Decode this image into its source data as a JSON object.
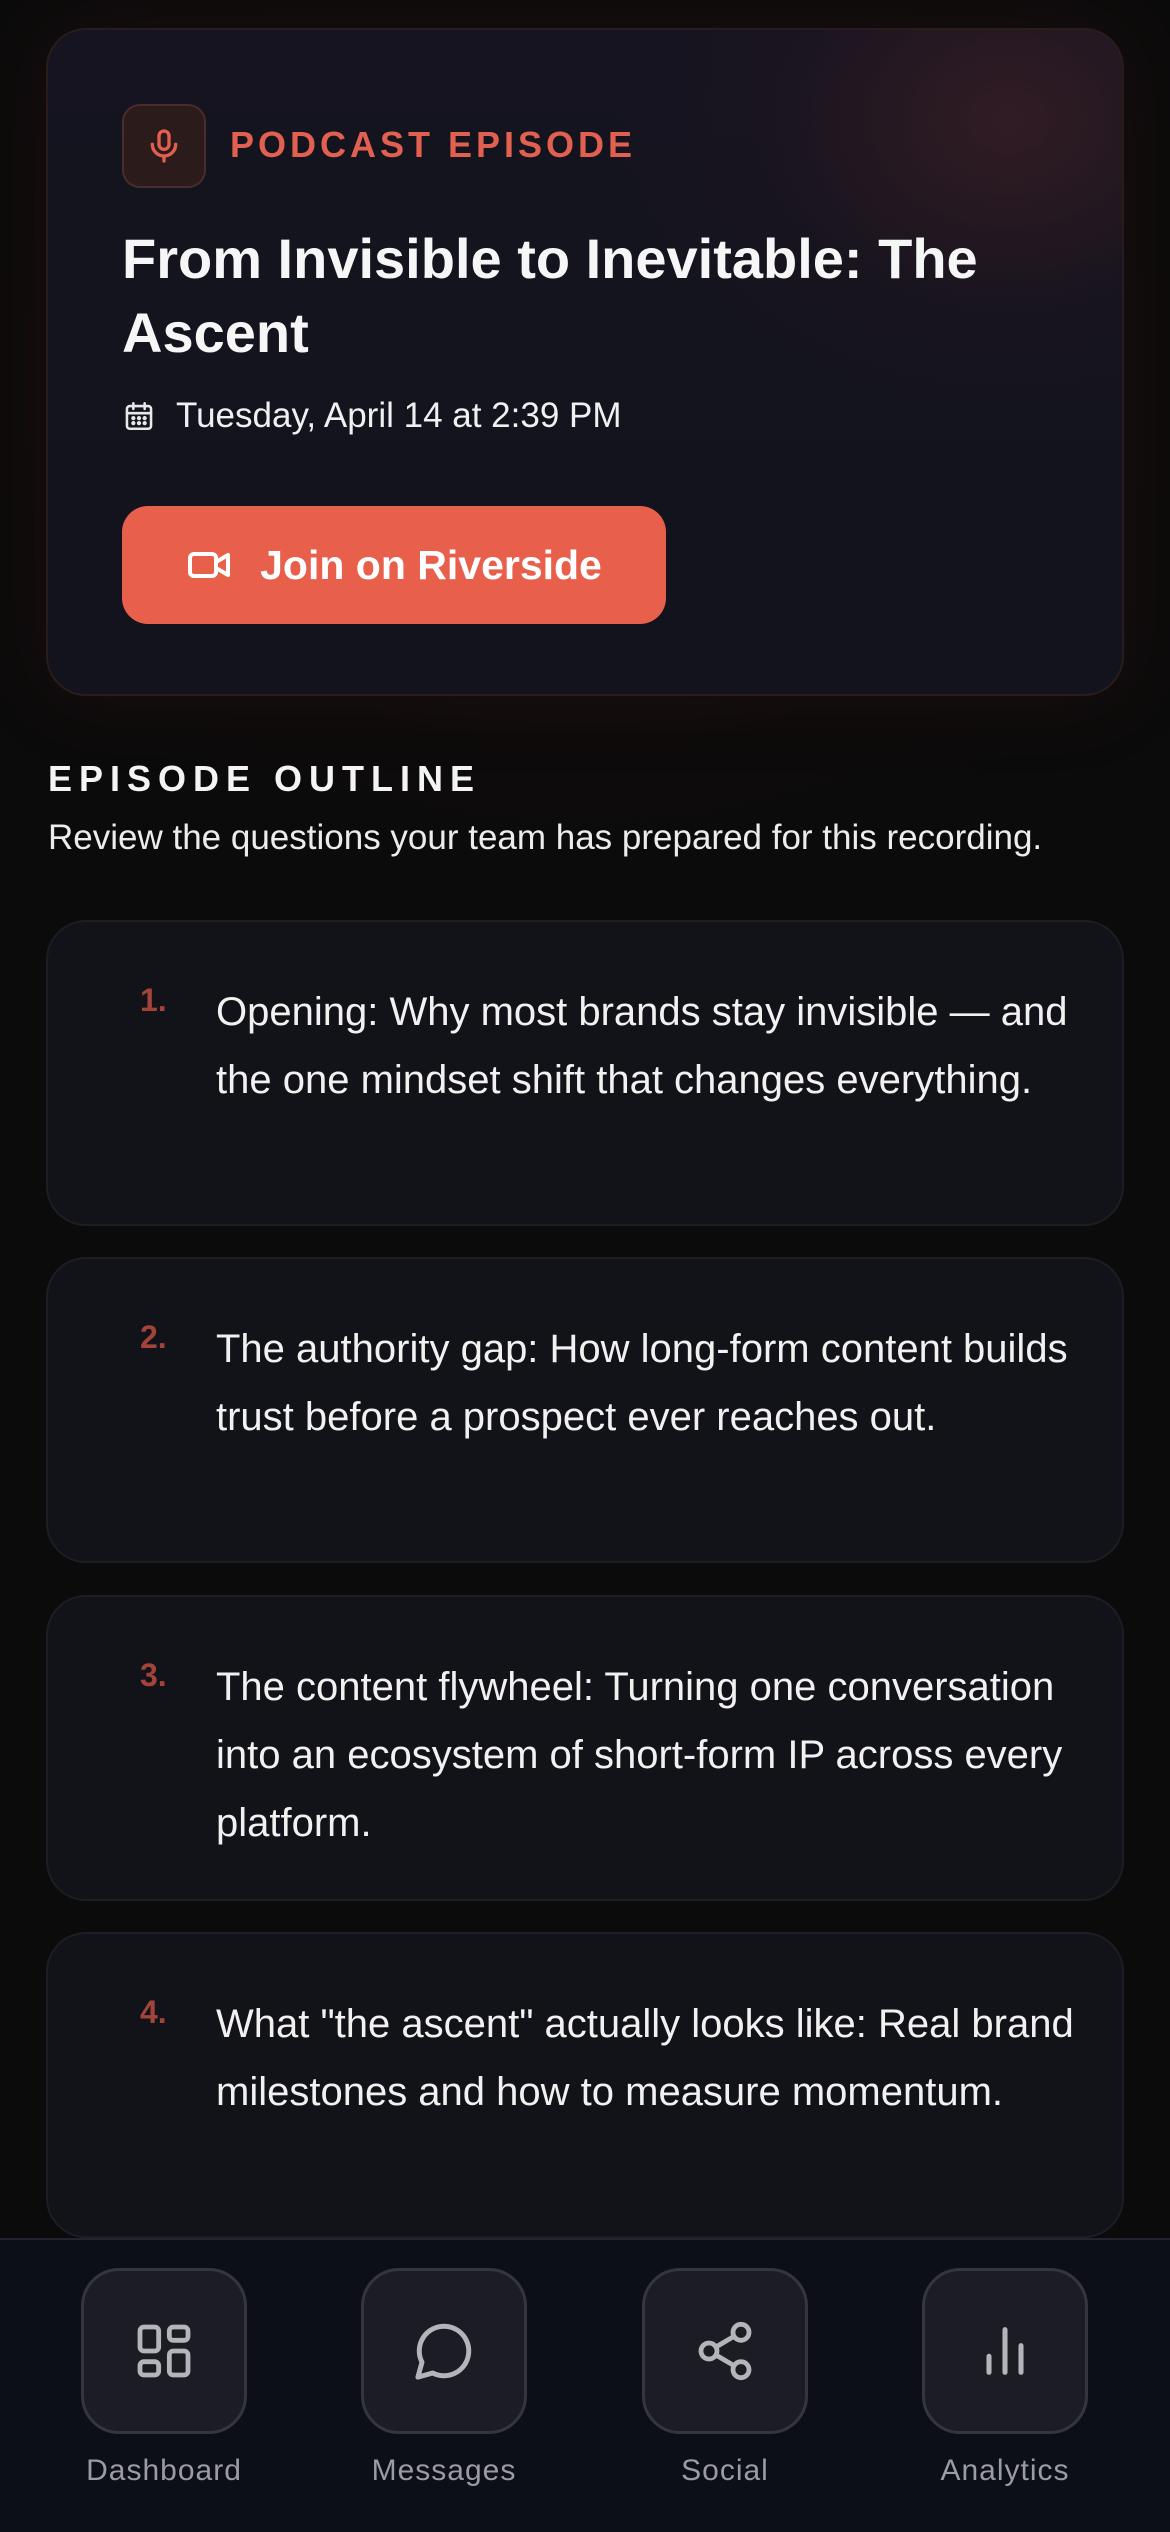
{
  "hero": {
    "kicker": "PODCAST EPISODE",
    "title": "From Invisible to Inevitable: The Ascent",
    "date": "Tuesday, April 14 at 2:39 PM",
    "join_label": "Join on Riverside",
    "badge_icon": "microphone-icon",
    "date_icon": "calendar-icon",
    "join_icon": "video-camera-icon",
    "accent_color": "#e8604c"
  },
  "outline": {
    "title": "EPISODE OUTLINE",
    "subtitle": "Review the questions your team has prepared for this recording.",
    "questions": [
      {
        "number": "1.",
        "text": "Opening: Why most brands stay invisible — and the one mindset shift that changes everything."
      },
      {
        "number": "2.",
        "text": "The authority gap: How long-form content builds trust before a prospect ever reaches out."
      },
      {
        "number": "3.",
        "text": "The content flywheel: Turning one conversation into an ecosystem of short-form IP across every platform."
      },
      {
        "number": "4.",
        "text": "What \"the ascent\" actually looks like: Real brand milestones and how to measure momentum."
      }
    ]
  },
  "nav": {
    "items": [
      {
        "label": "Dashboard",
        "icon": "dashboard-grid-icon"
      },
      {
        "label": "Messages",
        "icon": "chat-bubble-icon"
      },
      {
        "label": "Social",
        "icon": "share-icon"
      },
      {
        "label": "Analytics",
        "icon": "bar-chart-icon"
      }
    ]
  }
}
